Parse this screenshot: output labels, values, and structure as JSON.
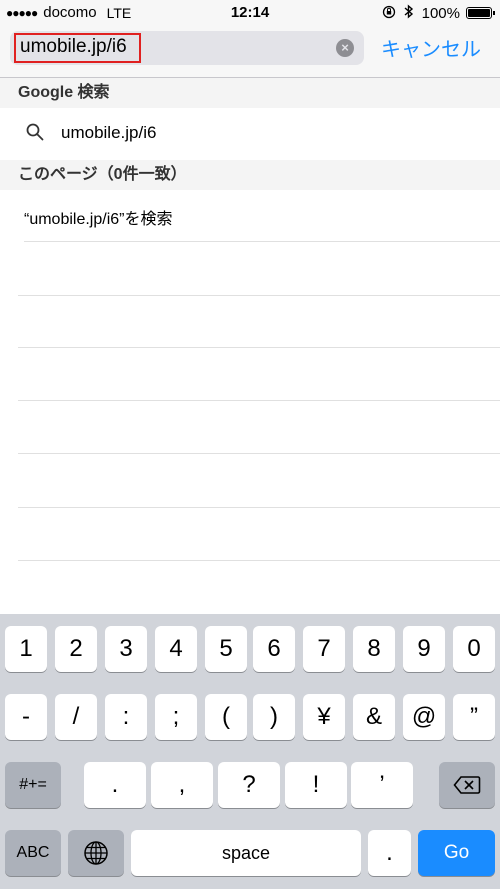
{
  "status_bar": {
    "signal": "●●●●●",
    "carrier": "docomo",
    "network": "LTE",
    "time": "12:14",
    "lock_icon": "orientation-lock-icon",
    "bluetooth_icon": "bluetooth-icon",
    "battery_percent": "100%",
    "battery_level": 1.0
  },
  "search": {
    "value": "umobile.jp/i6",
    "cancel_label": "キャンセル"
  },
  "sections": {
    "google_header": "Google 検索",
    "google_suggestion": "umobile.jp/i6",
    "page_header": "このページ（0件一致）",
    "page_find": "“umobile.jp/i6”を検索"
  },
  "keyboard": {
    "row1": [
      "1",
      "2",
      "3",
      "4",
      "5",
      "6",
      "7",
      "8",
      "9",
      "0"
    ],
    "row2": [
      "-",
      "/",
      ":",
      ";",
      "(",
      ")",
      "¥",
      "&",
      "@",
      "”"
    ],
    "row3_left": "#+=",
    "row3": [
      ".",
      ",",
      "?",
      "!",
      "’"
    ],
    "abc": "ABC",
    "space": "space",
    "period": ".",
    "go": "Go"
  },
  "colors": {
    "accent": "#1a8cff",
    "highlight": "#e02020"
  }
}
